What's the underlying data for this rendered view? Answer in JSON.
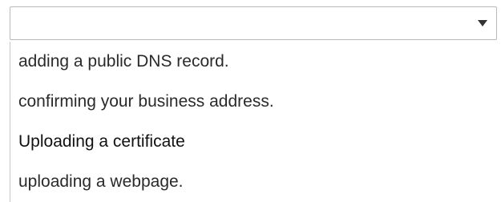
{
  "dropdown": {
    "selected_value": "",
    "arrow_icon": "chevron-down-icon",
    "options": [
      {
        "label": "adding a public DNS record."
      },
      {
        "label": "confirming your business address."
      },
      {
        "label": "Uploading a certificate"
      },
      {
        "label": "uploading a webpage."
      }
    ]
  }
}
